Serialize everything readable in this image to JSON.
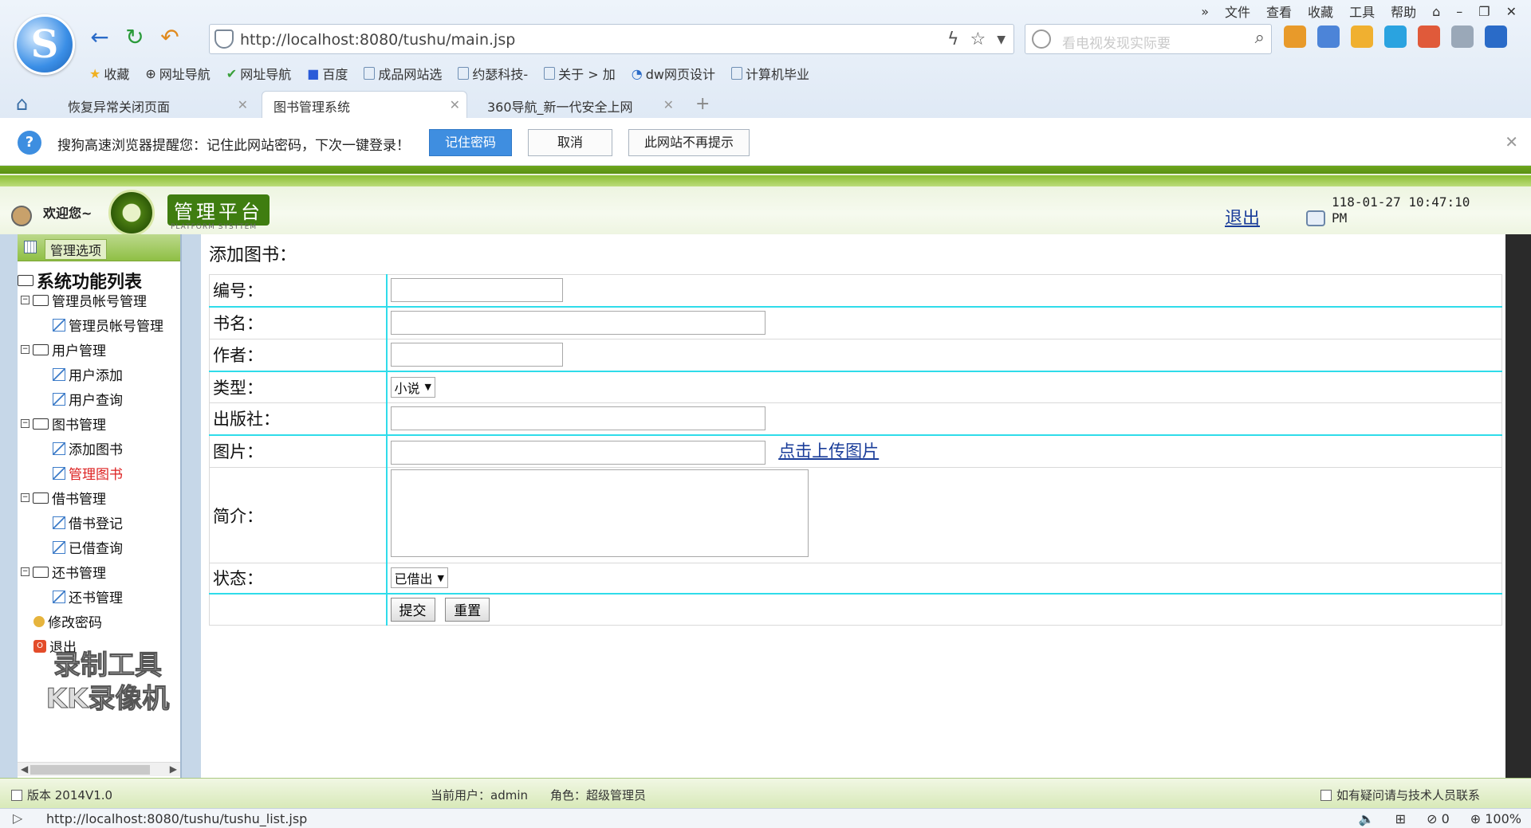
{
  "browser": {
    "menu": [
      "»",
      "文件",
      "查看",
      "收藏",
      "工具",
      "帮助"
    ],
    "address": "http://localhost:8080/tushu/main.jsp",
    "search_placeholder": "看电视发现实际要",
    "bookmarks": [
      "收藏",
      "网址导航",
      "网址导航",
      "百度",
      "成品网站选",
      "约瑟科技-",
      "关于 > 加",
      "dw网页设计",
      "计算机毕业"
    ],
    "tabs": [
      {
        "label": "恢复异常关闭页面"
      },
      {
        "label": "图书管理系统"
      },
      {
        "label": "360导航_新一代安全上网"
      }
    ],
    "new_tab": "+",
    "password_prompt": {
      "text": "搜狗高速浏览器提醒您：记住此网站密码，下次一键登录！",
      "remember": "记住密码",
      "cancel": "取消",
      "never": "此网站不再提示"
    },
    "status_url": "http://localhost:8080/tushu/tushu_list.jsp",
    "status_count": "0",
    "zoom": "100%"
  },
  "header": {
    "welcome": "欢迎您~",
    "platform_title": "管理平台",
    "platform_sub": "PLATFORM SYSYTEM",
    "logout": "退出",
    "datetime": "118-01-27 10:47:10 PM"
  },
  "sidebar": {
    "header": "管理选项",
    "root": "系统功能列表",
    "nodes": [
      {
        "label": "管理员帐号管理",
        "level": 1
      },
      {
        "label": "管理员帐号管理",
        "level": 2
      },
      {
        "label": "用户管理",
        "level": 1
      },
      {
        "label": "用户添加",
        "level": 2
      },
      {
        "label": "用户查询",
        "level": 2
      },
      {
        "label": "图书管理",
        "level": 1
      },
      {
        "label": "添加图书",
        "level": 2
      },
      {
        "label": "管理图书",
        "level": 2
      },
      {
        "label": "借书管理",
        "level": 1
      },
      {
        "label": "借书登记",
        "level": 2
      },
      {
        "label": "已借查询",
        "level": 2
      },
      {
        "label": "还书管理",
        "level": 1
      },
      {
        "label": "还书管理",
        "level": 2
      },
      {
        "label": "修改密码",
        "level": 1
      },
      {
        "label": "退出",
        "level": 1
      }
    ],
    "watermark_line1": "录制工具",
    "watermark_line2": "KK录像机"
  },
  "form": {
    "title": "添加图书：",
    "fields": {
      "id_label": "编号：",
      "name_label": "书名：",
      "author_label": "作者：",
      "type_label": "类型：",
      "type_value": "小说",
      "publisher_label": "出版社：",
      "image_label": "图片：",
      "upload_link": "点击上传图片",
      "intro_label": "简介：",
      "status_label": "状态：",
      "status_value": "已借出"
    },
    "submit": "提交",
    "reset": "重置"
  },
  "footer": {
    "version": "版本 2014V1.0",
    "current_user": "当前用户：admin",
    "role": "角色：超级管理员",
    "contact": "如有疑问请与技术人员联系"
  }
}
